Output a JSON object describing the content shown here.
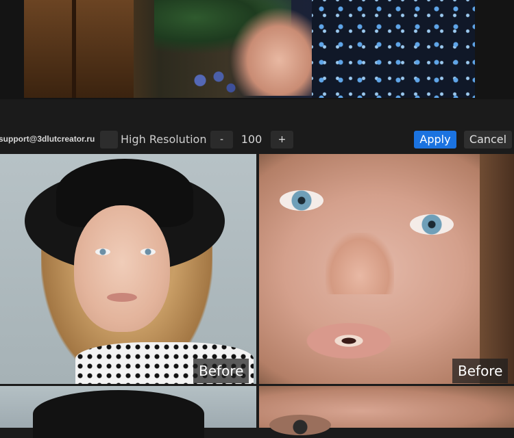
{
  "toolbar": {
    "support_email": "support@3dlutcreator.ru",
    "high_resolution_label": "High Resolution",
    "decrement_label": "-",
    "resolution_value": "100",
    "increment_label": "+",
    "apply_label": "Apply",
    "cancel_label": "Cancel"
  },
  "comparison": {
    "before_label_left": "Before",
    "before_label_right": "Before"
  },
  "colors": {
    "background": "#1b1b1b",
    "apply_button": "#1b73e0",
    "cancel_button": "#2f2f2f"
  }
}
